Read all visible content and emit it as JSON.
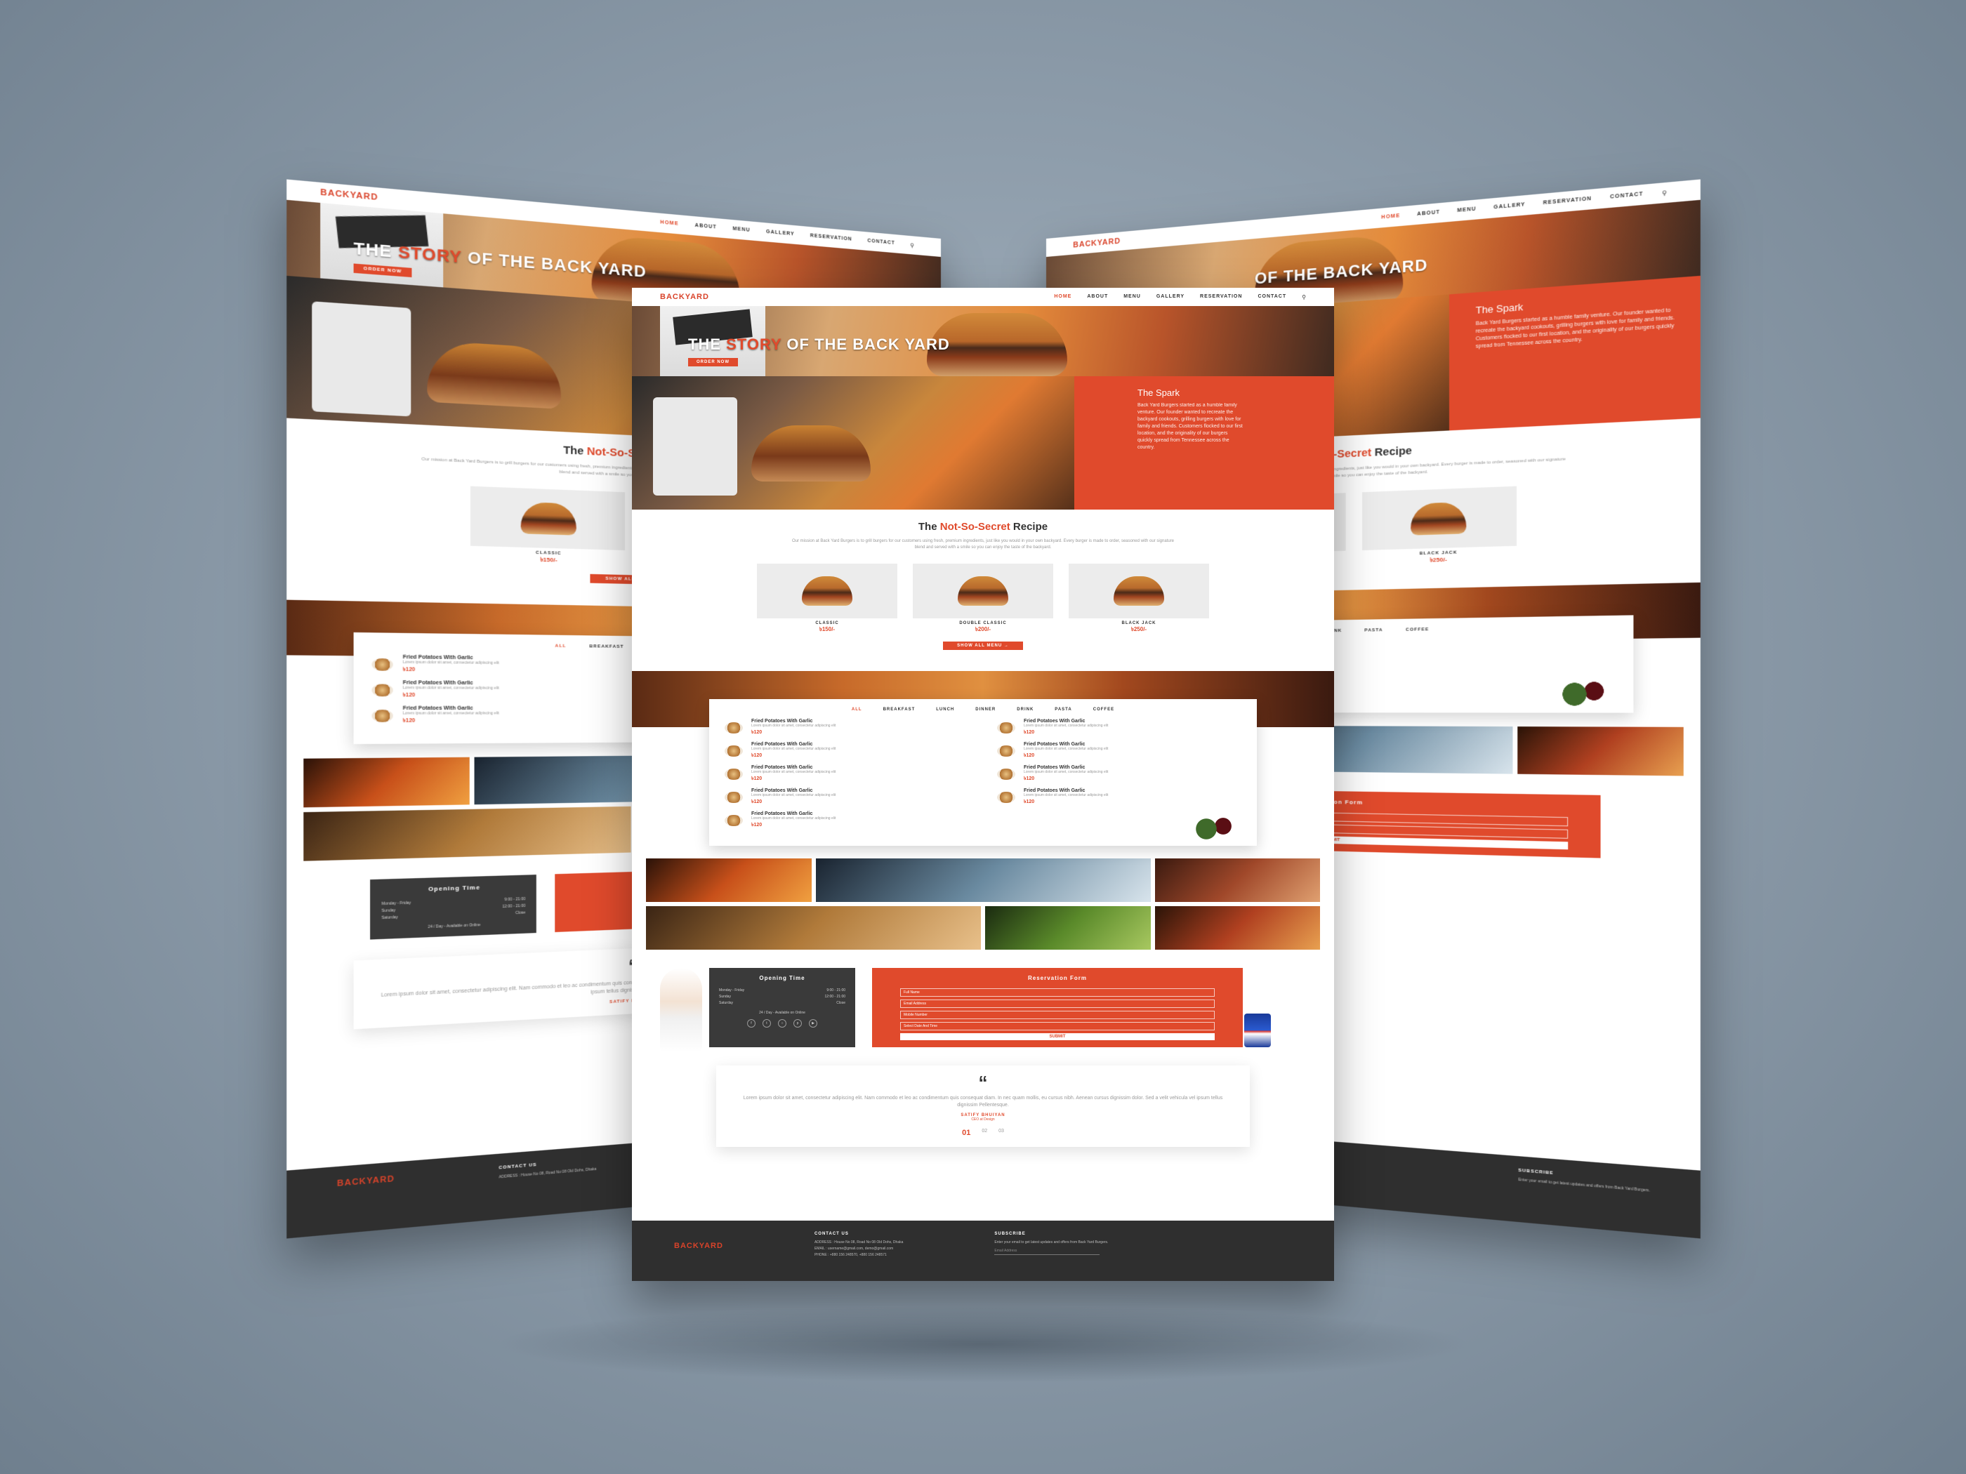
{
  "nav": {
    "logo": "BACKYARD",
    "links": [
      "HOME",
      "ABOUT",
      "MENU",
      "GALLERY",
      "RESERVATION",
      "CONTACT"
    ],
    "search_icon": "search-icon"
  },
  "hero": {
    "title_part1": "THE ",
    "title_highlight": "STORY",
    "title_part2": " OF THE BACK YARD",
    "button": "ORDER NOW"
  },
  "spark": {
    "title": "The Spark",
    "text": "Back Yard Burgers started as a humble family venture. Our founder wanted to recreate the backyard cookouts, grilling burgers with love for family and friends. Customers flocked to our first location, and the originality of our burgers quickly spread from Tennessee across the country."
  },
  "recipe": {
    "title_prefix": "The ",
    "title_highlight": "Not-So-Secret",
    "title_suffix": " Recipe",
    "text": "Our mission at Back Yard Burgers is to grill burgers for our customers using fresh, premium ingredients, just like you would in your own backyard. Every burger is made to order, seasoned with our signature blend and served with a smile so you can enjoy the taste of the backyard.",
    "items": [
      {
        "name": "CLASSIC",
        "price": "৳150/-"
      },
      {
        "name": "DOUBLE CLASSIC",
        "price": "৳200/-"
      },
      {
        "name": "BLACK JACK",
        "price": "৳250/-"
      }
    ],
    "show_all": "SHOW ALL MENU  →"
  },
  "menu": {
    "tabs": [
      "ALL",
      "BREAKFAST",
      "LUNCH",
      "DINNER",
      "DRINK",
      "PASTA",
      "COFFEE"
    ],
    "items_left": [
      {
        "name": "Fried Potatoes With Garlic",
        "desc": "Lorem ipsum dolor sit amet, consectetur adipiscing elit",
        "price": "৳120"
      },
      {
        "name": "Fried Potatoes With Garlic",
        "desc": "Lorem ipsum dolor sit amet, consectetur adipiscing elit",
        "price": "৳120"
      },
      {
        "name": "Fried Potatoes With Garlic",
        "desc": "Lorem ipsum dolor sit amet, consectetur adipiscing elit",
        "price": "৳120"
      },
      {
        "name": "Fried Potatoes With Garlic",
        "desc": "Lorem ipsum dolor sit amet, consectetur adipiscing elit",
        "price": "৳120"
      },
      {
        "name": "Fried Potatoes With Garlic",
        "desc": "Lorem ipsum dolor sit amet, consectetur adipiscing elit",
        "price": "৳120"
      }
    ],
    "items_right": [
      {
        "name": "Fried Potatoes With Garlic",
        "desc": "Lorem ipsum dolor sit amet, consectetur adipiscing elit",
        "price": "৳120"
      },
      {
        "name": "Fried Potatoes With Garlic",
        "desc": "Lorem ipsum dolor sit amet, consectetur adipiscing elit",
        "price": "৳120"
      },
      {
        "name": "Fried Potatoes With Garlic",
        "desc": "Lorem ipsum dolor sit amet, consectetur adipiscing elit",
        "price": "৳120"
      },
      {
        "name": "Fried Potatoes With Garlic",
        "desc": "Lorem ipsum dolor sit amet, consectetur adipiscing elit",
        "price": "৳120"
      }
    ]
  },
  "opening": {
    "title": "Opening Time",
    "rows": [
      {
        "day": "Monday - Friday",
        "time": "9:00 - 21:00"
      },
      {
        "day": "Sunday",
        "time": "12:00 - 21:00"
      },
      {
        "day": "Saturday",
        "time": "Close"
      }
    ],
    "note": "24 / Day - Available on Online",
    "social_icons": [
      "facebook-icon",
      "twitter-icon",
      "instagram-icon",
      "pinterest-icon",
      "youtube-icon"
    ]
  },
  "reservation": {
    "title": "Reservation Form",
    "fields": [
      "Full Name",
      "Email Address",
      "Mobile Number",
      "Select Date And Time"
    ],
    "submit": "SUBMIT"
  },
  "testimonial": {
    "quote": "Lorem ipsum dolor sit amet, consectetur adipiscing elit. Nam commodo et leo ac condimentum quis consequat diam. In nec quam mollis, eu cursus nibh. Aenean cursus dignissim dolor. Sed a velit vehicula vel ipsum tellus dignissim Pellentesque.",
    "name": "SATIFY BHUIYAN",
    "role": "CEO at Design",
    "pages": [
      "01",
      "02",
      "03"
    ]
  },
  "footer": {
    "logo": "BACKYARD",
    "contact_title": "CONTACT US",
    "contact_lines": [
      "ADDRESS : House No 08, Road No 08 Old Dohs, Dhaka",
      "EMAIL : username@gmail.com, demo@gmail.com",
      "PHONE : +880 156 248570, +880 156 248571"
    ],
    "subscribe_title": "SUBSCRIBE",
    "subscribe_text": "Enter your email to get latest updates and offers from Back Yard Burgers.",
    "subscribe_placeholder": "Email Address"
  },
  "colors": {
    "accent": "#e04a2c",
    "dark": "#2f2f2f",
    "background": "#8e9dab"
  }
}
